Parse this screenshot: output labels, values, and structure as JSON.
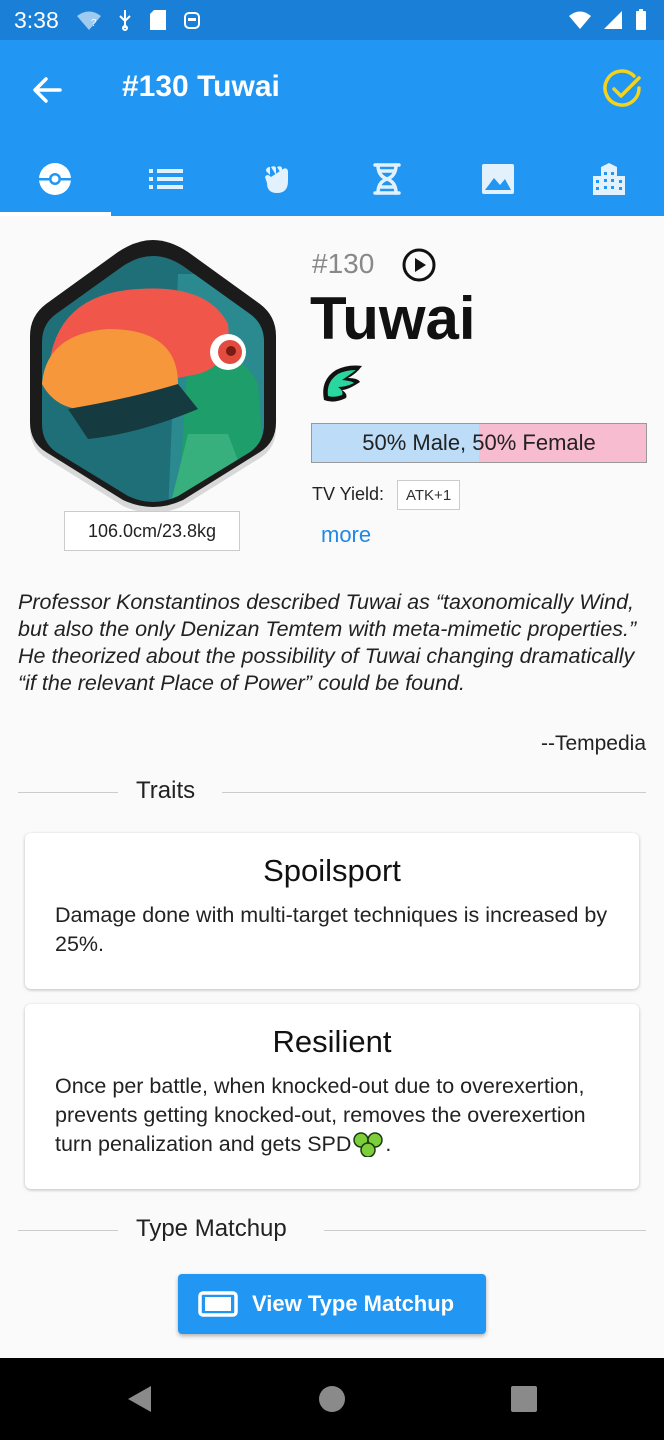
{
  "status_bar": {
    "time": "3:38"
  },
  "app_bar": {
    "title": "#130 Tuwai"
  },
  "tabs": [
    {
      "name": "tab-info",
      "icon": "pokeball-icon",
      "active": true
    },
    {
      "name": "tab-techniques",
      "icon": "list-icon",
      "active": false
    },
    {
      "name": "tab-stats",
      "icon": "fist-icon",
      "active": false
    },
    {
      "name": "tab-evolution",
      "icon": "dna-icon",
      "active": false
    },
    {
      "name": "tab-gallery",
      "icon": "image-icon",
      "active": false
    },
    {
      "name": "tab-locations",
      "icon": "buildings-icon",
      "active": false
    }
  ],
  "temtem": {
    "number": "#130",
    "name": "Tuwai",
    "size": "106.0cm/23.8kg",
    "gender": {
      "male_percent": 50,
      "label": "50% Male, 50% Female"
    },
    "tv_yield_label": "TV Yield:",
    "tv_yield_value": "ATK+1",
    "more_label": "more",
    "type_icon": "wind-type-icon",
    "quote": "Professor Konstantinos described Tuwai as “taxonomically Wind, but also the only Denizan Temtem with meta-mimetic properties.” He theorized about the possibility of Tuwai changing dramatically “if the relevant Place of Power” could be found.",
    "quote_source": "--Tempedia"
  },
  "traits": {
    "heading": "Traits",
    "items": [
      {
        "title": "Spoilsport",
        "description": "Damage done with multi-target techniques is increased by 25%."
      },
      {
        "title": "Resilient",
        "description": "Once per battle, when knocked-out due to overexertion, prevents getting knocked-out, removes the overexertion turn penalization and gets SPD",
        "suffix": "."
      }
    ]
  },
  "type_matchup": {
    "heading": "Type Matchup",
    "button_label": "View Type Matchup"
  },
  "colors": {
    "primary": "#2196f3",
    "status_bar": "#1a7fd6",
    "male": "#bcdcf8",
    "female": "#f7bccf",
    "link": "#1e88e5",
    "check": "#f5d21b",
    "wind": "#29d6a0"
  }
}
